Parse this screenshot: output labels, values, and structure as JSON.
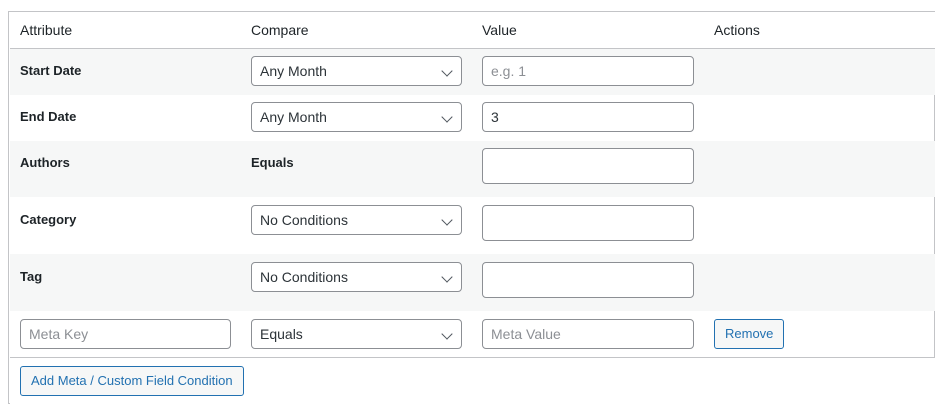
{
  "table": {
    "headers": {
      "attribute": "Attribute",
      "compare": "Compare",
      "value": "Value",
      "actions": "Actions"
    },
    "rows": [
      {
        "label": "Start Date",
        "compare": "Any Month",
        "value": "",
        "value_placeholder": "e.g. 1"
      },
      {
        "label": "End Date",
        "compare": "Any Month",
        "value": "3",
        "value_placeholder": ""
      },
      {
        "label": "Authors",
        "compare_static": "Equals",
        "value": "",
        "value_placeholder": ""
      },
      {
        "label": "Category",
        "compare": "No Conditions",
        "value": "",
        "value_placeholder": ""
      },
      {
        "label": "Tag",
        "compare": "No Conditions",
        "value": "",
        "value_placeholder": ""
      }
    ],
    "meta_row": {
      "key_placeholder": "Meta Key",
      "compare": "Equals",
      "value_placeholder": "Meta Value",
      "remove_label": "Remove"
    }
  },
  "footer": {
    "add_button_label": "Add Meta / Custom Field Condition"
  },
  "colors": {
    "accent": "#2271b1",
    "border": "#c3c4c7",
    "stripe": "#f6f7f7"
  }
}
